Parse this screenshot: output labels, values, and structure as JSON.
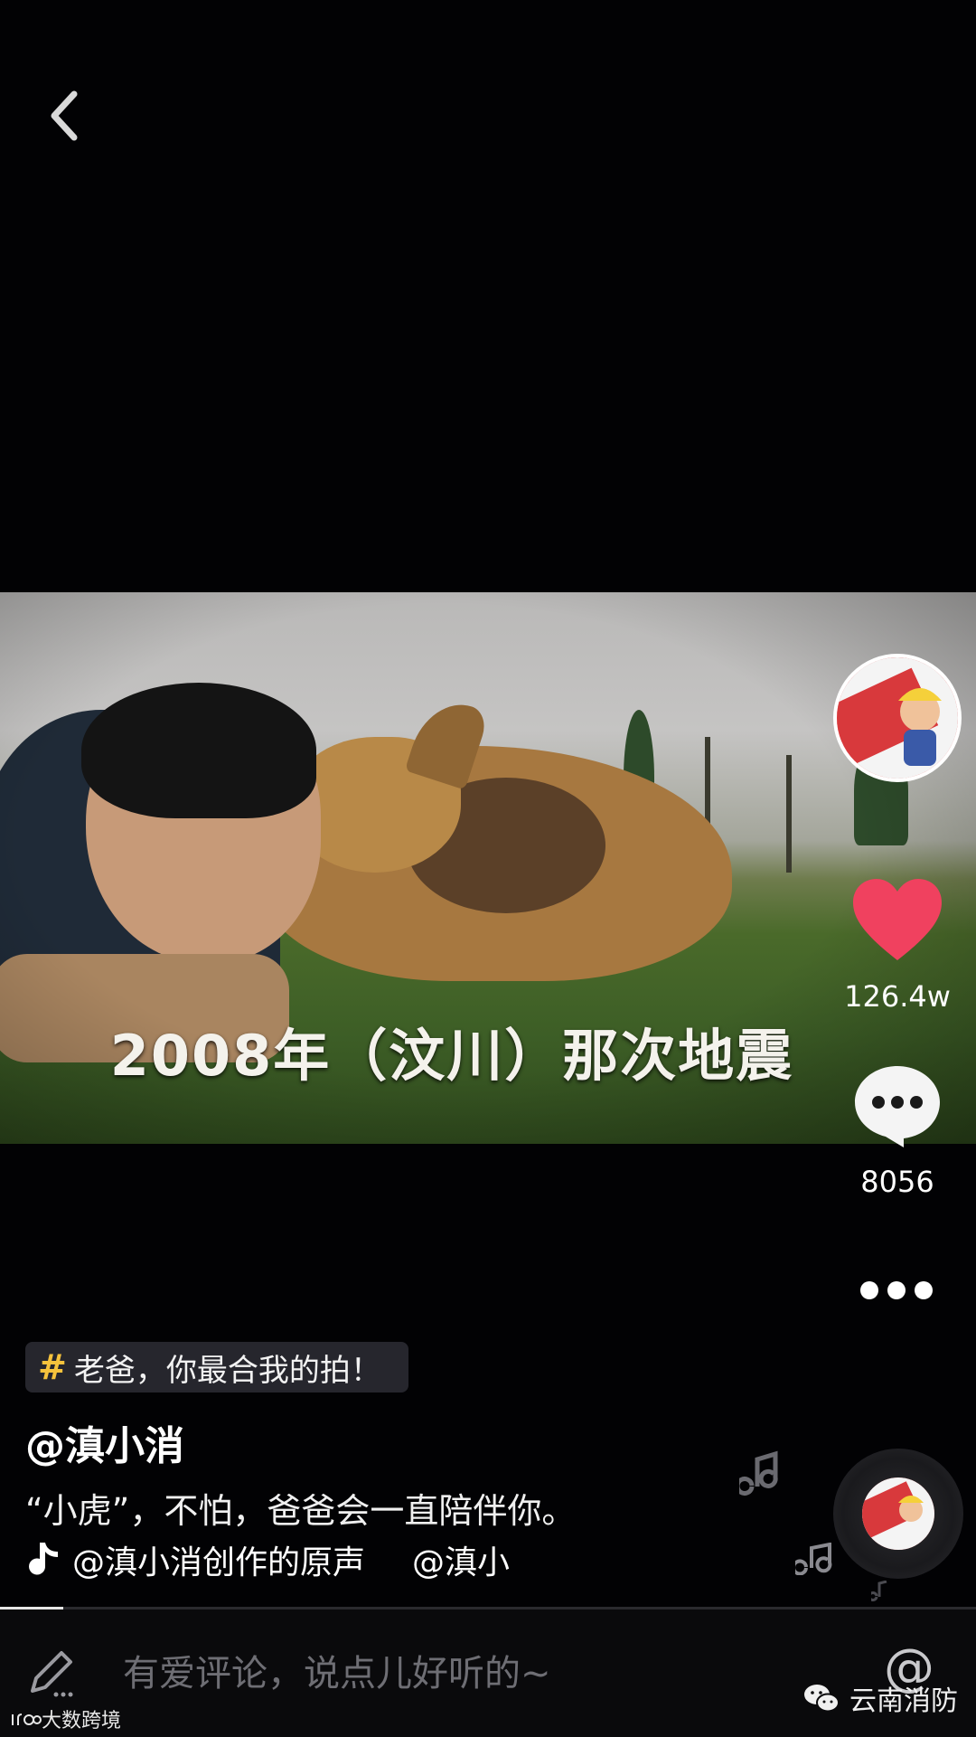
{
  "nav": {
    "back_icon": "chevron-left-icon"
  },
  "video": {
    "caption": "2008年（汶川）那次地震",
    "progress_fraction": 0.065
  },
  "creator": {
    "avatar_icon": "mascot-avatar"
  },
  "actions": {
    "like_count": "126.4w",
    "like_icon": "heart-icon",
    "like_color": "#f0415f",
    "comment_count": "8056",
    "comment_icon": "speech-bubble-icon",
    "more_icon": "ellipsis-icon"
  },
  "post": {
    "hashtag_symbol": "#",
    "hashtag": "老爸，你最合我的拍！",
    "hashtag_color": "#f5c23c",
    "author": "@滇小消",
    "description": "“小虎”，不怕，爸爸会一直陪伴你。",
    "music_text": "@滇小消创作的原声",
    "music_text_repeat": "@滇小"
  },
  "comment_bar": {
    "placeholder": "有爱评论，说点儿好听的~",
    "at_label": "@"
  },
  "watermarks": {
    "left": "大数跨境",
    "right": "云南消防"
  }
}
